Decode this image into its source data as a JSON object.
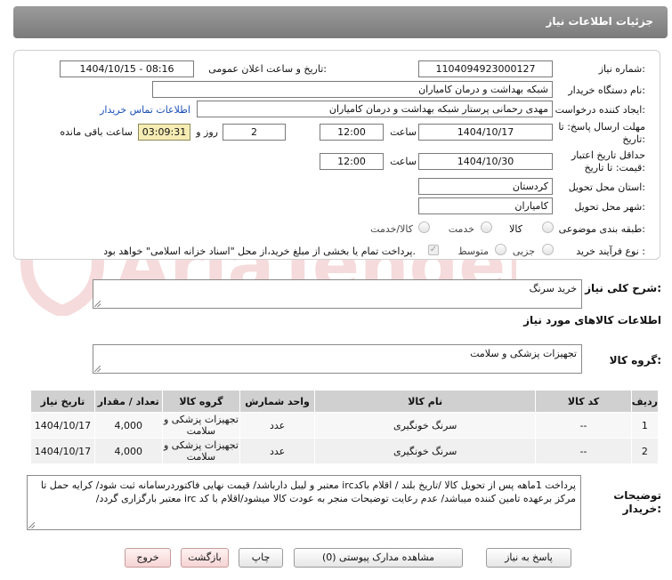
{
  "header": {
    "title": "جزئیات اطلاعات نیاز"
  },
  "fields": {
    "need_number": {
      "label": "شماره نیاز:",
      "value": "1104094923000127"
    },
    "announce_datetime": {
      "label": "تاریخ و ساعت اعلان عمومی:",
      "value": "1404/10/15 - 08:16"
    },
    "buyer_org": {
      "label": "نام دستگاه خریدار:",
      "value": "شبکه بهداشت و درمان کامیاران"
    },
    "creator": {
      "label": "ایجاد کننده درخواست:",
      "value": "مهدی رحمانی پرستار شبکه بهداشت و درمان کامیاران",
      "contact_link": "اطلاعات تماس خریدار"
    },
    "reply_deadline": {
      "label_line1": "مهلت ارسال پاسخ: تا",
      "label_line2": "تاریخ:",
      "date": "1404/10/17",
      "time_label": "ساعت",
      "time": "12:00",
      "days": "2",
      "days_label": "روز و",
      "remaining": "03:09:31",
      "remaining_label": "ساعت باقی مانده"
    },
    "price_validity": {
      "label_line1": "حداقل تاریخ اعتبار",
      "label_line2": "قیمت: تا تاریخ:",
      "date": "1404/10/30",
      "time_label": "ساعت",
      "time": "12:00"
    },
    "province": {
      "label": "استان محل تحویل:",
      "value": "کردستان"
    },
    "city": {
      "label": "شهر محل تحویل:",
      "value": "کامیاران"
    },
    "category": {
      "label": "طبقه بندی موضوعی:",
      "options": [
        "کالا",
        "خدمت",
        "کالا/خدمت"
      ]
    },
    "process": {
      "label": "نوع فرآیند خرید :",
      "options": [
        "جزیی",
        "متوسط"
      ],
      "treasury_note": "پرداخت تمام یا بخشی از مبلغ خرید،از محل \"اسناد خزانه اسلامی\" خواهد بود."
    }
  },
  "description": {
    "label": "شرح کلی نیاز:",
    "value": "خرید سرنگ"
  },
  "goods_info_title": "اطلاعات کالاهای مورد نیاز",
  "goods_group": {
    "label": "گروه کالا:",
    "value": "تجهیزات پزشکی و سلامت"
  },
  "table": {
    "headers": [
      "ردیف",
      "کد کالا",
      "نام کالا",
      "واحد شمارش",
      "گروه کالا",
      "تعداد / مقدار",
      "تاریخ نیاز"
    ],
    "rows": [
      {
        "row": "1",
        "code": "--",
        "name": "سرنگ خونگیری",
        "unit": "عدد",
        "group": "تجهیزات پزشکی و سلامت",
        "qty": "4,000",
        "date": "1404/10/17"
      },
      {
        "row": "2",
        "code": "--",
        "name": "سرنگ خونگیری",
        "unit": "عدد",
        "group": "تجهیزات پزشکی و سلامت",
        "qty": "4,000",
        "date": "1404/10/17"
      }
    ]
  },
  "buyer_notes": {
    "label_line1": "توضیحات",
    "label_line2": "خریدار:",
    "value": "پرداخت 1ماهه پس از تحویل کالا /تاریخ بلند / اقلام باکدirc معتبر و لیبل دارباشد/ قیمت نهایی فاکتوردرسامانه ثبت شود/ کرایه حمل تا مرکز برعهده تامین کننده میباشد/ عدم رعایت توضیحات منجر به عودت کالا میشود/اقلام با کد irc معتبر بارگزاری گردد/"
  },
  "buttons": {
    "reply": "پاسخ به نیاز",
    "attachments": "مشاهده مدارک پیوستی (0)",
    "print": "چاپ",
    "back": "بازگشت",
    "exit": "خروج"
  },
  "watermark": {
    "text": "AriaTender.neT"
  },
  "colors": {
    "header_bg": "#8a8a8a",
    "link": "#1a4fb5",
    "remaining_bg": "#f6ecb4",
    "watermark": "#c62828"
  }
}
